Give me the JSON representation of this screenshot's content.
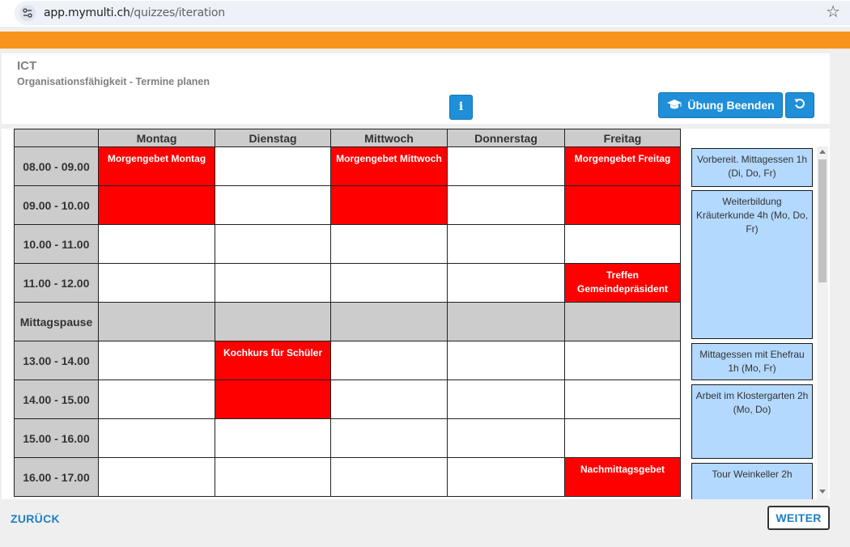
{
  "browser": {
    "url_host": "app.mymulti.ch",
    "url_path": "/quizzes/iteration"
  },
  "header": {
    "course": "ICT",
    "exercise": "Organisationsfähigkeit - Termine planen",
    "info_icon": "i",
    "end_label": "Übung Beenden"
  },
  "schedule": {
    "days": [
      "Montag",
      "Dienstag",
      "Mittwoch",
      "Donnerstag",
      "Freitag"
    ],
    "rows": [
      {
        "time": "08.00 - 09.00",
        "cells": [
          {
            "filled": true,
            "label": "Morgengebet Montag"
          },
          {
            "filled": false,
            "label": ""
          },
          {
            "filled": true,
            "label": "Morgengebet Mittwoch"
          },
          {
            "filled": false,
            "label": ""
          },
          {
            "filled": true,
            "label": "Morgengebet Freitag"
          }
        ]
      },
      {
        "time": "09.00 - 10.00",
        "cells": [
          {
            "filled": true,
            "label": ""
          },
          {
            "filled": false,
            "label": ""
          },
          {
            "filled": true,
            "label": ""
          },
          {
            "filled": false,
            "label": ""
          },
          {
            "filled": true,
            "label": ""
          }
        ]
      },
      {
        "time": "10.00 - 11.00",
        "cells": [
          {
            "filled": false,
            "label": ""
          },
          {
            "filled": false,
            "label": ""
          },
          {
            "filled": false,
            "label": ""
          },
          {
            "filled": false,
            "label": ""
          },
          {
            "filled": false,
            "label": ""
          }
        ]
      },
      {
        "time": "11.00 - 12.00",
        "cells": [
          {
            "filled": false,
            "label": ""
          },
          {
            "filled": false,
            "label": ""
          },
          {
            "filled": false,
            "label": ""
          },
          {
            "filled": false,
            "label": ""
          },
          {
            "filled": true,
            "label": "Treffen Gemeindepräsident"
          }
        ]
      },
      {
        "time": "Mittagspause",
        "pause": true,
        "cells": [
          {
            "filled": false,
            "label": ""
          },
          {
            "filled": false,
            "label": ""
          },
          {
            "filled": false,
            "label": ""
          },
          {
            "filled": false,
            "label": ""
          },
          {
            "filled": false,
            "label": ""
          }
        ]
      },
      {
        "time": "13.00 - 14.00",
        "cells": [
          {
            "filled": false,
            "label": ""
          },
          {
            "filled": true,
            "label": "Kochkurs für Schüler"
          },
          {
            "filled": false,
            "label": ""
          },
          {
            "filled": false,
            "label": ""
          },
          {
            "filled": false,
            "label": ""
          }
        ]
      },
      {
        "time": "14.00 - 15.00",
        "cells": [
          {
            "filled": false,
            "label": ""
          },
          {
            "filled": true,
            "label": ""
          },
          {
            "filled": false,
            "label": ""
          },
          {
            "filled": false,
            "label": ""
          },
          {
            "filled": false,
            "label": ""
          }
        ]
      },
      {
        "time": "15.00 - 16.00",
        "cells": [
          {
            "filled": false,
            "label": ""
          },
          {
            "filled": false,
            "label": ""
          },
          {
            "filled": false,
            "label": ""
          },
          {
            "filled": false,
            "label": ""
          },
          {
            "filled": false,
            "label": ""
          }
        ]
      },
      {
        "time": "16.00 - 17.00",
        "cells": [
          {
            "filled": false,
            "label": ""
          },
          {
            "filled": false,
            "label": ""
          },
          {
            "filled": false,
            "label": ""
          },
          {
            "filled": false,
            "label": ""
          },
          {
            "filled": true,
            "label": "Nachmittagsgebet"
          }
        ]
      }
    ]
  },
  "tasks": [
    {
      "label": "Vorbereit. Mittagessen 1h (Di, Do, Fr)"
    },
    {
      "label": "Weiterbildung Kräuterkunde 4h (Mo, Do, Fr)"
    },
    {
      "label": "Mittagessen mit Ehefrau 1h (Mo, Fr)"
    },
    {
      "label": "Arbeit im Klostergarten 2h (Mo, Do)"
    },
    {
      "label": "Tour Weinkeller 2h"
    }
  ],
  "footer": {
    "back_label": "ZURÜCK",
    "next_label": "WEITER"
  },
  "colors": {
    "accent": "#f7941d",
    "button": "#1e8fd8",
    "appointment": "#ff0000",
    "task": "#b3d9ff",
    "link": "#1e7fc4"
  }
}
